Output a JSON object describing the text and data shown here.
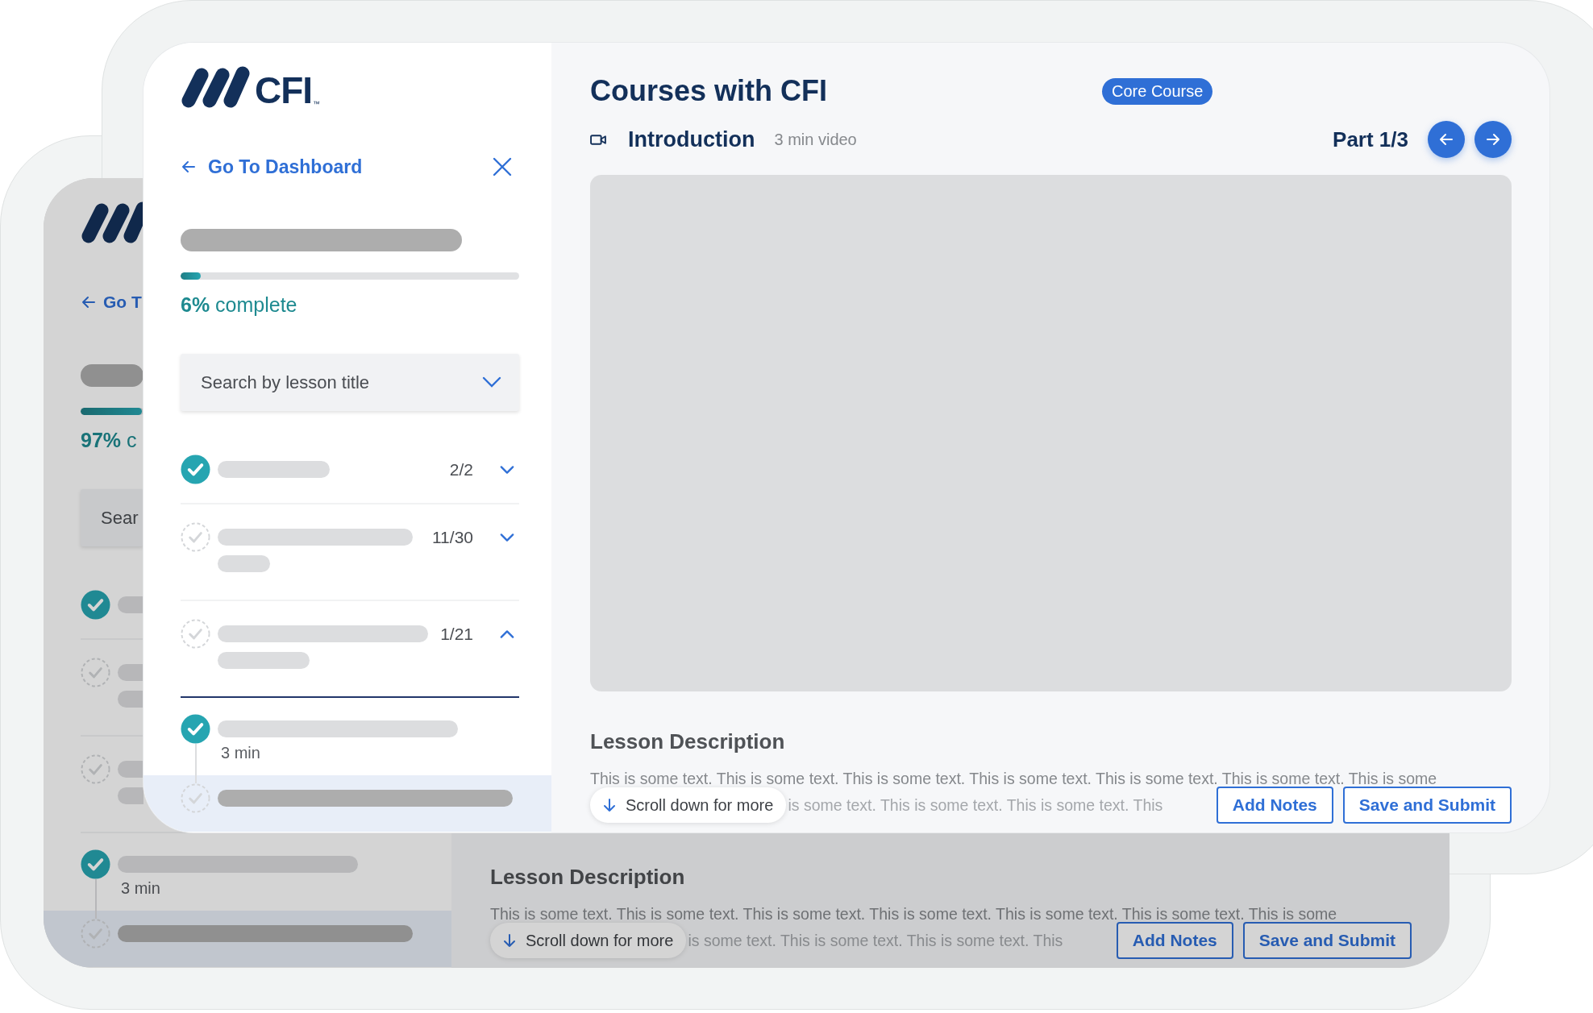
{
  "back": {
    "sidebar": {
      "back_link": "Go T",
      "progress": {
        "level": 0.97,
        "text": "**97%** c"
      },
      "search": {
        "placeholder": "Sear"
      },
      "sections": [
        {
          "checked": true
        },
        {
          "checked": false
        },
        {
          "checked": false,
          "children": [
            {
              "checked": true,
              "duration": "3 min",
              "selected": false
            },
            {
              "checked": false,
              "selected": true
            }
          ]
        }
      ]
    },
    "main": {
      "description": {
        "heading": "Lesson Description",
        "line_1": "This is some text. This is some text. This is some text. This is some text. This is some text. This is some text. This is some",
        "line_2": "is some text. This is some text. This is some text. This"
      },
      "scroll_hint": "Scroll down for more",
      "buttons": [
        "Add Notes",
        "Save and Submit"
      ]
    }
  },
  "front": {
    "sidebar": {
      "logo_text": "CFI",
      "logo_mark": "™",
      "back_link": "Go To Dashboard",
      "close_button": true,
      "progress": {
        "level": 0.06,
        "text": "**6%** complete"
      },
      "search": {
        "placeholder": "Search by lesson title"
      },
      "sections": [
        {
          "checked": true,
          "count": "2/2",
          "expanded": false
        },
        {
          "checked": false,
          "count": "11/30",
          "expanded": false
        },
        {
          "checked": false,
          "count": "1/21",
          "expanded": true,
          "children": [
            {
              "checked": true,
              "duration": "3 min",
              "selected": false
            },
            {
              "checked": false,
              "selected": true
            }
          ]
        }
      ]
    },
    "main": {
      "title": "Courses with CFI",
      "badge": "Core Course",
      "lesson": {
        "title": "Introduction",
        "meta": "3 min video"
      },
      "part": "Part 1/3",
      "description": {
        "heading": "Lesson Description",
        "line_1": "This is some text. This is some text. This is some text. This is some text. This is some text. This is some text. This is some",
        "line_2": "is some text. This is some text. This is some text. This"
      },
      "scroll_hint": "Scroll down for more",
      "buttons": [
        "Add Notes",
        "Save and Submit"
      ]
    }
  }
}
